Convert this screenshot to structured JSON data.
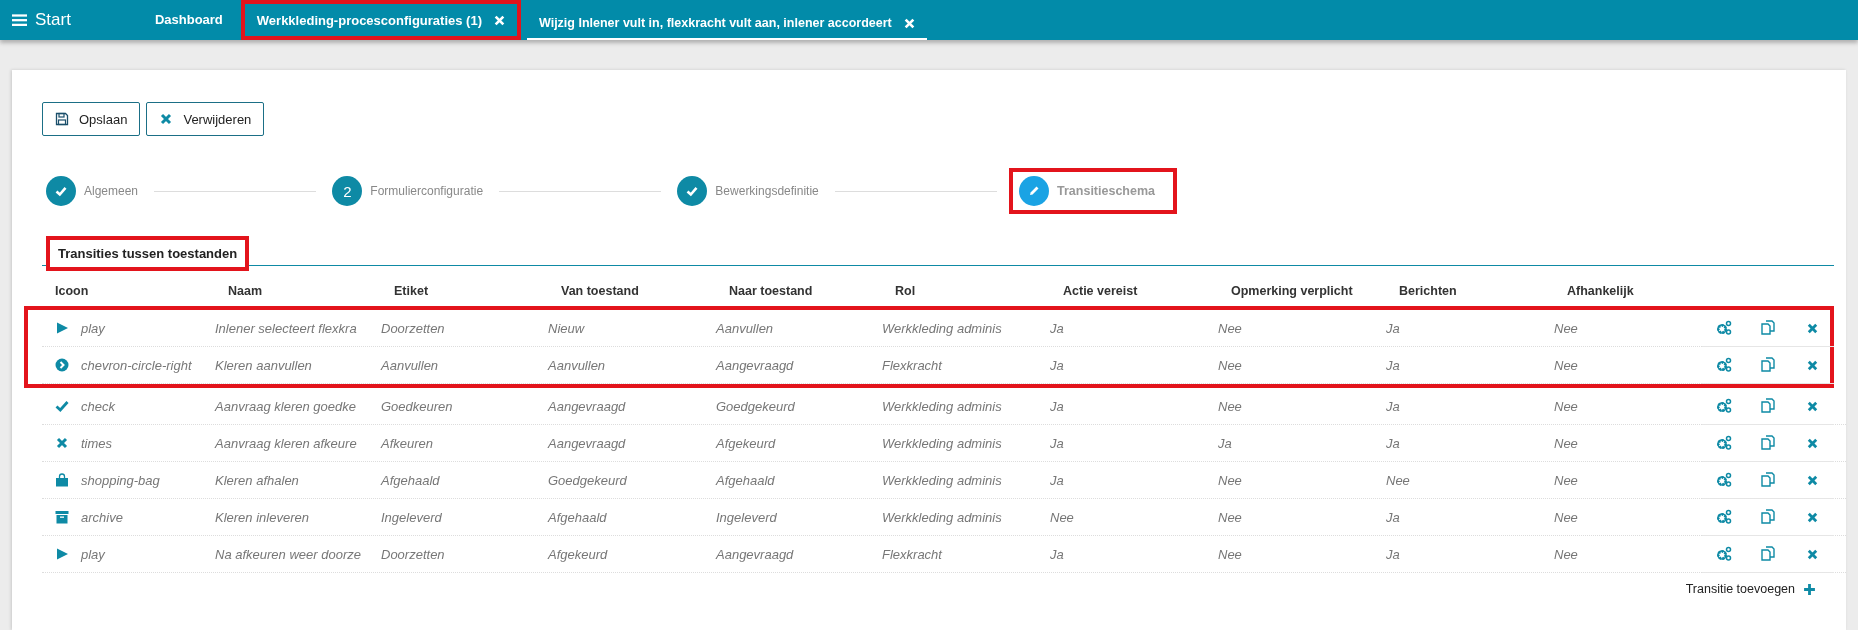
{
  "topbar": {
    "menu_label": "Start",
    "tabs": [
      {
        "label": "Dashboard",
        "selected": false,
        "closable": false,
        "highlighted": false
      },
      {
        "label": "Werkkleding-procesconfiguraties (1)",
        "selected": false,
        "closable": true,
        "highlighted": true
      },
      {
        "label": "Wijzig Inlener vult in, flexkracht vult aan, inlener accordeert",
        "selected": true,
        "closable": true,
        "highlighted": false
      }
    ]
  },
  "toolbar": [
    {
      "kind": "save",
      "label": "Opslaan"
    },
    {
      "kind": "delete",
      "label": "Verwijderen"
    }
  ],
  "steps": [
    {
      "label": "Algemeen",
      "kind": "done",
      "highlighted": false
    },
    {
      "label": "Formulierconfiguratie",
      "kind": "todo",
      "number": "2",
      "highlighted": false
    },
    {
      "label": "Bewerkingsdefinitie",
      "kind": "done",
      "highlighted": false
    },
    {
      "label": "Transitieschema",
      "kind": "active",
      "highlighted": true
    }
  ],
  "section": {
    "title": "Transities tussen toestanden",
    "highlighted": true
  },
  "table": {
    "columns": [
      "Icoon",
      "Naam",
      "Etiket",
      "Van toestand",
      "Naar toestand",
      "Rol",
      "Actie vereist",
      "Opmerking verplicht",
      "Berichten",
      "Afhankelijk"
    ],
    "rows": [
      {
        "kind": "play",
        "cells": [
          "play",
          "Inlener selecteert flexkra",
          "Doorzetten",
          "Nieuw",
          "Aanvullen",
          "Werkkleding adminis",
          "Ja",
          "Nee",
          "Ja",
          "Nee"
        ],
        "highlighted": true
      },
      {
        "kind": "chevron",
        "cells": [
          "chevron-circle-right",
          "Kleren aanvullen",
          "Aanvullen",
          "Aanvullen",
          "Aangevraagd",
          "Flexkracht",
          "Ja",
          "Nee",
          "Ja",
          "Nee"
        ],
        "highlighted": true
      },
      {
        "kind": "check",
        "cells": [
          "check",
          "Aanvraag kleren goedke",
          "Goedkeuren",
          "Aangevraagd",
          "Goedgekeurd",
          "Werkkleding adminis",
          "Ja",
          "Nee",
          "Ja",
          "Nee"
        ],
        "highlighted": false
      },
      {
        "kind": "times",
        "cells": [
          "times",
          "Aanvraag kleren afkeure",
          "Afkeuren",
          "Aangevraagd",
          "Afgekeurd",
          "Werkkleding adminis",
          "Ja",
          "Ja",
          "Ja",
          "Nee"
        ],
        "highlighted": false
      },
      {
        "kind": "bag",
        "cells": [
          "shopping-bag",
          "Kleren afhalen",
          "Afgehaald",
          "Goedgekeurd",
          "Afgehaald",
          "Werkkleding adminis",
          "Ja",
          "Nee",
          "Nee",
          "Nee"
        ],
        "highlighted": false
      },
      {
        "kind": "archive",
        "cells": [
          "archive",
          "Kleren inleveren",
          "Ingeleverd",
          "Afgehaald",
          "Ingeleverd",
          "Werkkleding adminis",
          "Nee",
          "Nee",
          "Ja",
          "Nee"
        ],
        "highlighted": false
      },
      {
        "kind": "play",
        "cells": [
          "play",
          "Na afkeuren weer doorze",
          "Doorzetten",
          "Afgekeurd",
          "Aangevraagd",
          "Flexkracht",
          "Ja",
          "Nee",
          "Ja",
          "Nee"
        ],
        "highlighted": false
      }
    ]
  },
  "add_button": {
    "label": "Transitie toevoegen"
  }
}
